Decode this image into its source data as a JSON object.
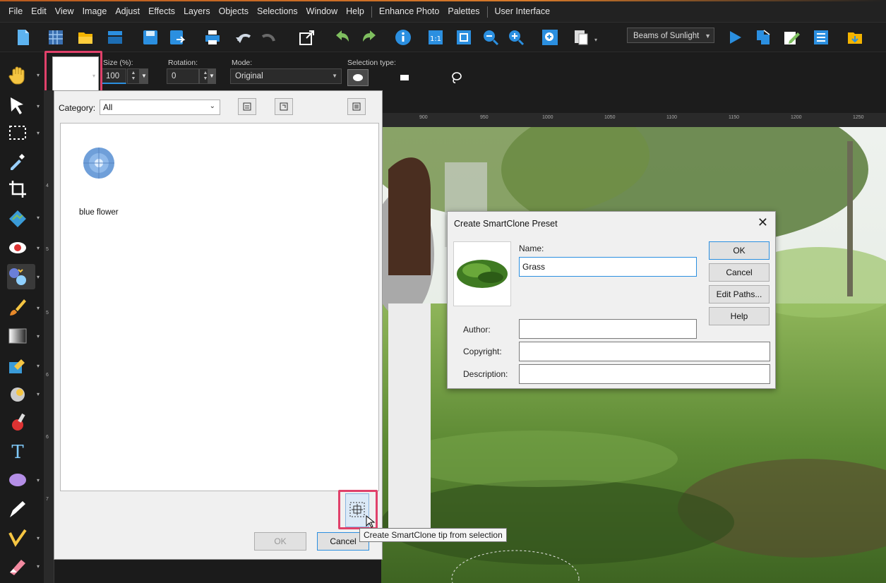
{
  "menu": {
    "items": [
      "File",
      "Edit",
      "View",
      "Image",
      "Adjust",
      "Effects",
      "Layers",
      "Objects",
      "Selections",
      "Window",
      "Help"
    ],
    "extra_items": [
      "Enhance Photo",
      "Palettes"
    ],
    "ui_item": "User Interface"
  },
  "toolbar": {
    "preset_dropdown": "Beams of Sunlight",
    "icons": [
      "new-file-icon",
      "browse-icon",
      "open-icon",
      "scan-icon",
      "save-icon",
      "save-as-icon",
      "print-icon",
      "undo-icon",
      "redo-icon",
      "resize-icon",
      "rotate-left-icon",
      "rotate-right-icon",
      "info-icon",
      "actual-size-icon",
      "fit-window-icon",
      "zoom-out-icon",
      "zoom-in-icon",
      "zoom-to-icon",
      "paste-icon",
      "play-icon",
      "script-icon",
      "edit-script-icon",
      "list-icon",
      "folder-icon"
    ]
  },
  "options": {
    "size_label": "Size (%):",
    "size_value": "100",
    "rotation_label": "Rotation:",
    "rotation_value": "0",
    "mode_label": "Mode:",
    "mode_value": "Original",
    "selection_type_label": "Selection type:"
  },
  "ruler": {
    "h_ticks": [
      "900",
      "950",
      "1000",
      "1050",
      "1100",
      "1150",
      "1200",
      "1250"
    ],
    "v_ticks": [
      "4",
      "5",
      "5",
      "6",
      "6",
      "7"
    ]
  },
  "tip_dialog": {
    "category_label": "Category:",
    "category_value": "All",
    "tip_name": "blue flower",
    "ok_label": "OK",
    "cancel_label": "Cancel"
  },
  "tooltip": "Create SmartClone tip from selection",
  "preset_dialog": {
    "title": "Create SmartClone Preset",
    "name_label": "Name:",
    "name_value": "Grass",
    "author_label": "Author:",
    "author_value": "",
    "copyright_label": "Copyright:",
    "copyright_value": "",
    "description_label": "Description:",
    "description_value": "",
    "ok_label": "OK",
    "cancel_label": "Cancel",
    "edit_paths_label": "Edit Paths...",
    "help_label": "Help"
  },
  "colors": {
    "highlight": "#e0416a",
    "accent": "#d77a2a",
    "toolbar_blue": "#2b8fe0"
  }
}
